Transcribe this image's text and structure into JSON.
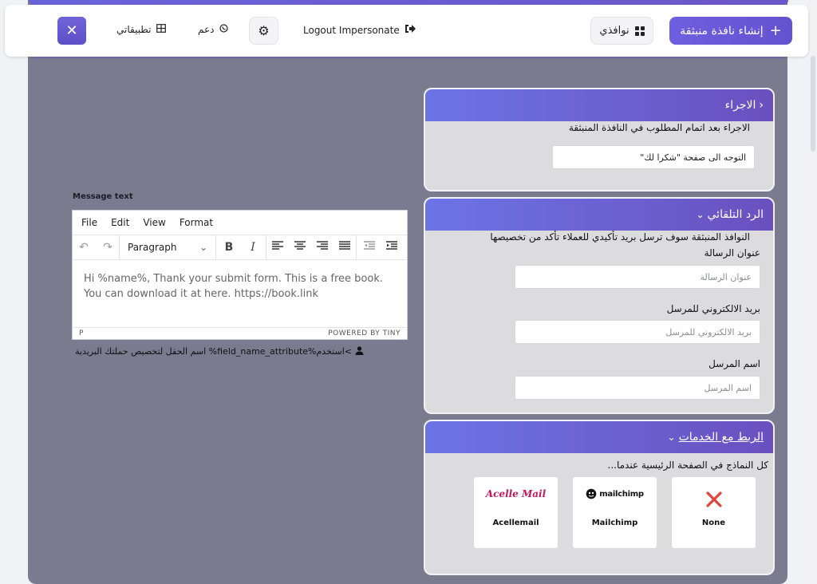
{
  "header": {
    "create_popup_label": "إنشاء نافذة منبثقة",
    "windows_label": "نوافذي",
    "logout_label": "Logout Impersonate",
    "support_label": "دعم",
    "apps_label": "تطبيقاتي"
  },
  "editor": {
    "message_label": "Message text",
    "menu": [
      "File",
      "Edit",
      "View",
      "Format"
    ],
    "block_format": "Paragraph",
    "content": "Hi %name%, Thank your submit form. This is a free book. You can download it at here. https://book.link",
    "status_path": "P",
    "powered_by": "POWERED BY TINY",
    "help_text": ">استخدم%field_name_attribute% اسم الحقل لتخصيص حملتك البريدية"
  },
  "action_card": {
    "title": "الاجراء",
    "description": "الاجراء بعد اتمام المطلوب في النافذة المنبثقة",
    "select_value": "التوجه الى صفحة \"شكرا لك\""
  },
  "autoresponder_card": {
    "title": "الرد التلقائي",
    "description": "النوافذ المنبثقة سوف ترسل بريد تأكيدي للعملاء تأكد من تخصيصها",
    "subject_label": "عنوان الرسالة",
    "subject_placeholder": "عنوان الرسالة",
    "sender_email_label": "بريد الالكتروني للمرسل",
    "sender_email_placeholder": "بريد الالكتروني للمرسل",
    "sender_name_label": "اسم المرسل",
    "sender_name_placeholder": "اسم المرسل"
  },
  "integration_card": {
    "title": "الربط مع الخدمات",
    "description": "كل النماذج في الصفحة الرئيسية عندما...",
    "services": [
      {
        "name": "None",
        "logo": "x-icon"
      },
      {
        "name": "Mailchimp",
        "logo": "mailchimp"
      },
      {
        "name": "Acellemail",
        "logo": "Acelle Mail"
      }
    ]
  },
  "colors": {
    "accent_start": "#6c74e6",
    "accent_end": "#6a50bf",
    "backdrop": "#7a7b8f",
    "card_bg": "#dcdcde",
    "none_red": "#e0443a"
  }
}
